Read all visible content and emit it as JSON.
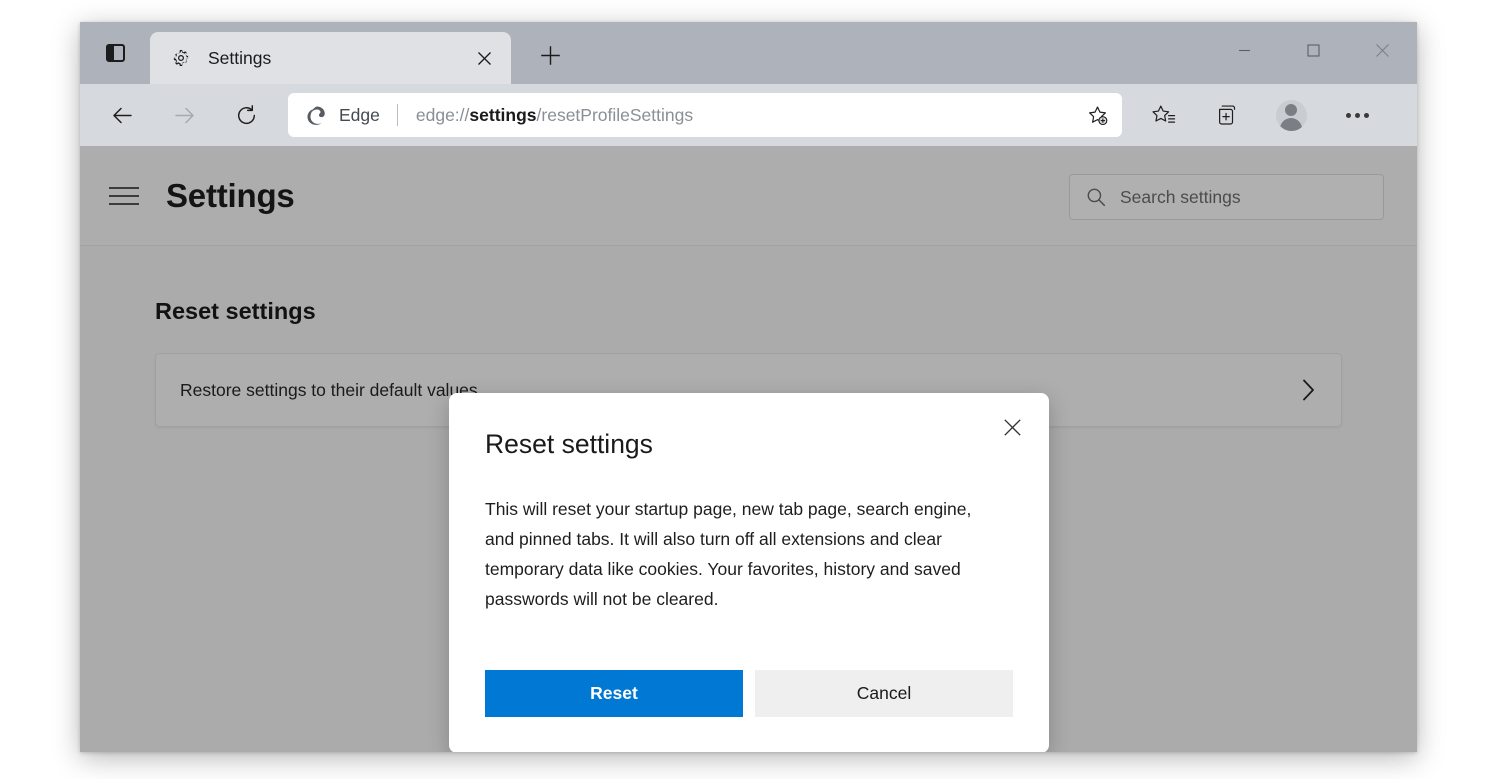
{
  "window": {
    "controls": {
      "minimize": "—",
      "maximize": "□",
      "close": "✕"
    }
  },
  "tabstrip": {
    "tab_actions_label": "tab-actions",
    "tabs": [
      {
        "title": "Settings",
        "favicon": "gear-icon",
        "close_label": "✕"
      }
    ],
    "new_tab_label": "+"
  },
  "toolbar": {
    "back_label": "←",
    "forward_label": "→",
    "refresh_label": "↻",
    "address": {
      "brand_label": "Edge",
      "separator": "|",
      "url_prefix": "edge://",
      "url_emphasis": "settings",
      "url_suffix": "/resetProfileSettings",
      "full_url": "edge://settings/resetProfileSettings"
    },
    "favorite_add_label": "add-favorite",
    "favorites_label": "favorites",
    "collections_label": "collections",
    "profile_label": "profile",
    "more_label": "settings-and-more"
  },
  "settings": {
    "page_title": "Settings",
    "menu_label": "menu",
    "search": {
      "placeholder": "Search settings",
      "value": "Search settings",
      "icon": "search-icon"
    },
    "section_title": "Reset settings",
    "rows": [
      {
        "label": "Restore settings to their default values",
        "chevron": "chevron-right-icon"
      }
    ]
  },
  "dialog": {
    "title": "Reset settings",
    "body": "This will reset your startup page, new tab page, search engine, and pinned tabs. It will also turn off all extensions and clear temporary data like cookies. Your favorites, history and saved passwords will not be cleared.",
    "close_label": "✕",
    "primary_button": "Reset",
    "secondary_button": "Cancel"
  },
  "colors": {
    "accent": "#0078d4",
    "dialog_background": "#ffffff",
    "page_dim": "#ababab",
    "toolbar": "#d6d9dd",
    "titlebar": "#aeb3bb",
    "active_tab": "#dfe1e4"
  }
}
